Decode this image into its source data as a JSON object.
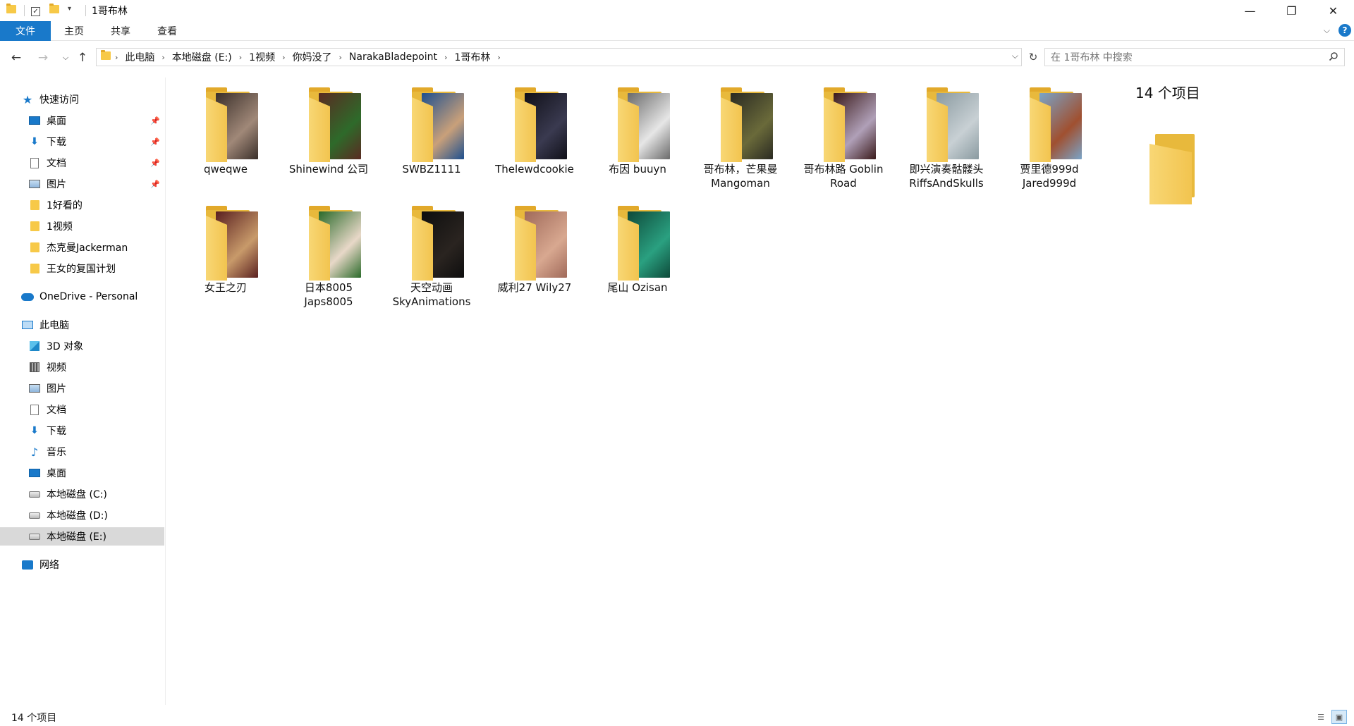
{
  "window": {
    "title": "1哥布林",
    "minimize": "—",
    "maximize": "❐",
    "close": "✕"
  },
  "ribbon": {
    "tabs": [
      "文件",
      "主页",
      "共享",
      "查看"
    ],
    "help": "?"
  },
  "address": {
    "crumbs": [
      "此电脑",
      "本地磁盘 (E:)",
      "1视频",
      "你妈没了",
      "NarakaBladepoint",
      "1哥布林"
    ],
    "search_placeholder": "在 1哥布林 中搜索"
  },
  "sidebar": {
    "quick_access": "快速访问",
    "quick_items": [
      "桌面",
      "下载",
      "文档",
      "图片",
      "1好看的",
      "1视频",
      "杰克曼Jackerman",
      "王女的复国计划"
    ],
    "onedrive": "OneDrive - Personal",
    "this_pc": "此电脑",
    "pc_items": [
      "3D 对象",
      "视频",
      "图片",
      "文档",
      "下载",
      "音乐",
      "桌面",
      "本地磁盘 (C:)",
      "本地磁盘 (D:)",
      "本地磁盘 (E:)"
    ],
    "network": "网络"
  },
  "folders": [
    {
      "name": "qweqwe",
      "c1": "#3a2f2a",
      "c2": "#a08878"
    },
    {
      "name": "Shinewind 公司",
      "c1": "#5a2a22",
      "c2": "#2e6a2a"
    },
    {
      "name": "SWBZ1111",
      "c1": "#1d4f8f",
      "c2": "#c9a07a"
    },
    {
      "name": "Thelewdcookie",
      "c1": "#101018",
      "c2": "#3a3a50"
    },
    {
      "name": "布因 buuyn",
      "c1": "#6a6a6a",
      "c2": "#e6e6e6"
    },
    {
      "name": "哥布林，芒果曼\nMangoman",
      "c1": "#2a2a22",
      "c2": "#6a6a3a"
    },
    {
      "name": "哥布林路 Goblin\nRoad",
      "c1": "#3a1a1a",
      "c2": "#b0a0b8"
    },
    {
      "name": "即兴演奏骷髅头\nRiffsAndSkulls",
      "c1": "#8a9aa0",
      "c2": "#c8d0d4"
    },
    {
      "name": "贾里德999d\nJared999d",
      "c1": "#7aa4c8",
      "c2": "#a05030"
    },
    {
      "name": "女王之刃",
      "c1": "#5a2020",
      "c2": "#c89a6a"
    },
    {
      "name": "日本8005\nJaps8005",
      "c1": "#2a6a2a",
      "c2": "#e8d8c8"
    },
    {
      "name": "天空动画\nSkyAnimations",
      "c1": "#0e0e0e",
      "c2": "#2a2420"
    },
    {
      "name": "威利27 Wily27",
      "c1": "#a06a5a",
      "c2": "#d8a890"
    },
    {
      "name": "尾山 Ozisan",
      "c1": "#0e4a3a",
      "c2": "#2aa080"
    }
  ],
  "details": {
    "count": "14 个项目"
  },
  "status": {
    "count": "14 个项目"
  }
}
